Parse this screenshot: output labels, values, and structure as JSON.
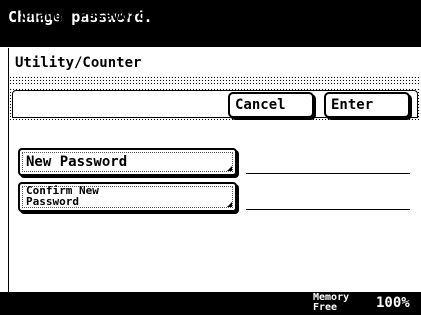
{
  "title_bar": {
    "message": "Change password."
  },
  "breadcrumb": {
    "label": "Utility/Counter"
  },
  "panel": {
    "title": "Change Password",
    "cancel_label": "Cancel",
    "enter_label": "Enter"
  },
  "fields": {
    "new_password": {
      "label": "New Password",
      "value": ""
    },
    "confirm_password": {
      "label_line1": "Confirm New",
      "label_line2": "Password",
      "value": ""
    }
  },
  "status_bar": {
    "memory_label_line1": "Memory",
    "memory_label_line2": "Free",
    "memory_value": "100%"
  }
}
